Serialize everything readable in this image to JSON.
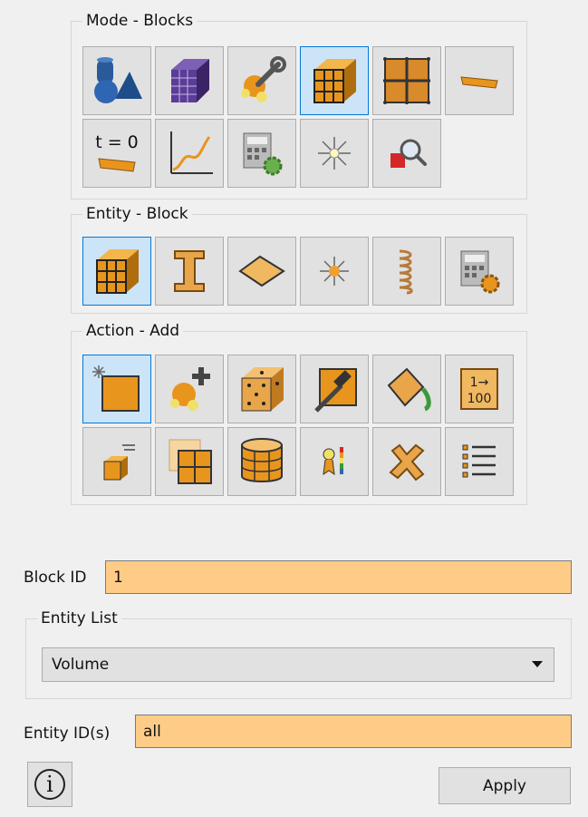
{
  "mode_group": {
    "title": "Mode - Blocks"
  },
  "entity_group": {
    "title": "Entity - Block"
  },
  "action_group": {
    "title": "Action - Add"
  },
  "mode_row1_icons": [
    "geometry-icon",
    "mesh-icon",
    "tools-wrench-icon",
    "blocks-cube-icon",
    "grid-icon",
    "strip-icon"
  ],
  "mode_row2_icons": [
    "time-zero-icon",
    "graph-curve-icon",
    "calculator-settings-icon",
    "light-burst-icon",
    "search-zoom-icon"
  ],
  "entity_icons": [
    "block-cube-icon",
    "ibeam-icon",
    "surface-diamond-icon",
    "vertex-burst-icon",
    "spring-coil-icon",
    "calculator-settings-icon"
  ],
  "action_row1_icons": [
    "new-block-icon",
    "add-geometry-icon",
    "node-box-icon",
    "hammer-edit-icon",
    "paint-bucket-icon",
    "numbering-icon"
  ],
  "action_row2_icons": [
    "cube-list-icon",
    "grid-tiles-icon",
    "cylinder-grid-icon",
    "ribbon-colorbar-icon",
    "delete-x-icon",
    "list-lines-icon"
  ],
  "time_zero_text": "t = 0",
  "numbering_top": "1→",
  "numbering_bottom": "100",
  "form": {
    "block_id_label": "Block ID",
    "block_id_value": "1",
    "entity_list_title": "Entity List",
    "entity_list_selected": "Volume",
    "entity_ids_label": "Entity ID(s)",
    "entity_ids_value": "all",
    "apply_label": "Apply",
    "info_glyph": "i"
  },
  "colors": {
    "highlight_input": "#ffcc88",
    "active_button": "#cce4f7",
    "active_border": "#0078d7",
    "orange": "#e8951e"
  }
}
